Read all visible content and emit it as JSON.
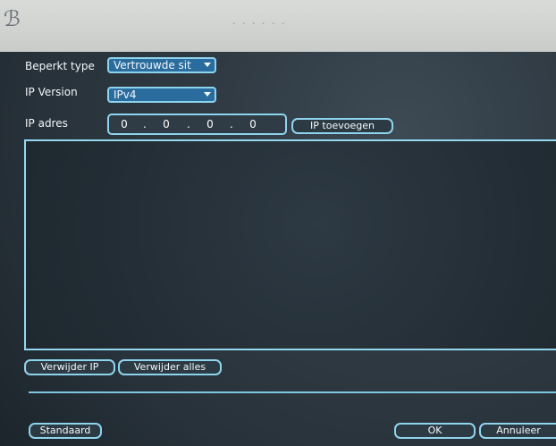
{
  "window": {
    "title": "· · · · · ·"
  },
  "fields": {
    "restricted_type_label": "Beperkt type",
    "restricted_type_value": "Vertrouwde sit",
    "ip_version_label": "IP Version",
    "ip_version_value": "IPv4",
    "ip_address_label": "IP adres",
    "ip_octets": [
      "0",
      "0",
      "0",
      "0"
    ]
  },
  "buttons": {
    "add_ip": "IP toevoegen",
    "remove_ip": "Verwijder IP",
    "remove_all": "Verwijder alles",
    "default": "Standaard",
    "ok": "OK",
    "cancel": "Annuleer"
  },
  "colors": {
    "accent_border": "#8fd4ee",
    "select_fill": "#2a6c9e",
    "panel": "#28323a"
  }
}
